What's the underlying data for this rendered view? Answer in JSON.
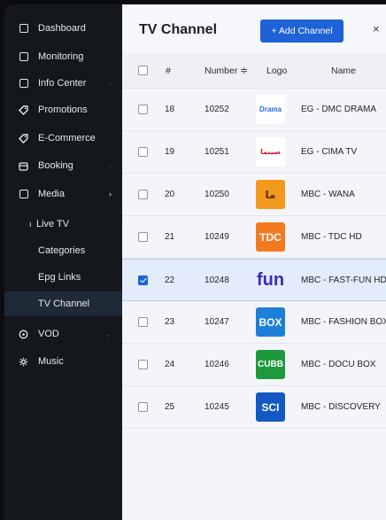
{
  "sidebar": {
    "items": [
      {
        "label": "Dashboard",
        "icon": "dashboard-icon",
        "chevron": false
      },
      {
        "label": "Monitoring",
        "icon": "monitoring-icon",
        "chevron": false
      },
      {
        "label": "Info Center",
        "icon": "info-center-icon",
        "chevron": true
      },
      {
        "label": "Promotions",
        "icon": "promotions-icon",
        "chevron": false
      },
      {
        "label": "E-Commerce",
        "icon": "ecommerce-icon",
        "chevron": false
      },
      {
        "label": "Booking",
        "icon": "booking-icon",
        "chevron": true
      },
      {
        "label": "Media",
        "icon": "media-icon",
        "chevron": true
      }
    ],
    "media_children": [
      {
        "label": "Live TV"
      },
      {
        "label": "Categories"
      },
      {
        "label": "Epg Links"
      },
      {
        "label": "TV Channel"
      }
    ],
    "bottom_items": [
      {
        "label": "VOD",
        "icon": "vod-icon",
        "chevron": true
      },
      {
        "label": "Music",
        "icon": "music-icon",
        "chevron": false
      }
    ]
  },
  "header": {
    "title": "TV Channel",
    "add_button": "+ Add Channel",
    "close": "×"
  },
  "table": {
    "columns": {
      "index": "#",
      "number": "Number ≑",
      "logo": "Logo",
      "name": "Name"
    },
    "rows": [
      {
        "index": "18",
        "number": "10252",
        "name": "EG - DMC DRAMA",
        "logo_text": "Drama",
        "logo_bg": "#ffffff",
        "logo_fg": "#2a6be0",
        "checked": false
      },
      {
        "index": "19",
        "number": "10251",
        "name": "EG - CIMA TV",
        "logo_text": "سينما",
        "logo_bg": "#ffffff",
        "logo_fg": "#c71b2a",
        "checked": false
      },
      {
        "index": "20",
        "number": "10250",
        "name": "MBC - WANA",
        "logo_text": "ما",
        "logo_bg": "#f39a1e",
        "logo_fg": "#5a2a00",
        "checked": false
      },
      {
        "index": "21",
        "number": "10249",
        "name": "MBC - TDC HD",
        "logo_text": "TDC",
        "logo_bg": "#f47a20",
        "logo_fg": "#ffffff",
        "checked": false
      },
      {
        "index": "22",
        "number": "10248",
        "name": "MBC - FAST-FUN HD",
        "logo_text": "fun",
        "logo_bg": "transparent",
        "logo_fg": "#3d2ab6",
        "checked": true
      },
      {
        "index": "23",
        "number": "10247",
        "name": "MBC - FASHION BOX",
        "logo_text": "BOX",
        "logo_bg": "#1d7fd8",
        "logo_fg": "#ffffff",
        "checked": false
      },
      {
        "index": "24",
        "number": "10246",
        "name": "MBC - DOCU BOX",
        "logo_text": "CUBB",
        "logo_bg": "#1e9a3c",
        "logo_fg": "#ffffff",
        "checked": false
      },
      {
        "index": "25",
        "number": "10245",
        "name": "MBC - DISCOVERY",
        "logo_text": "SCI",
        "logo_bg": "#1259c4",
        "logo_fg": "#ffffff",
        "checked": false
      }
    ]
  },
  "colors": {
    "accent": "#1e62d6",
    "sidebar_bg": "#14171c",
    "selected_row": "#e3ecfa"
  }
}
